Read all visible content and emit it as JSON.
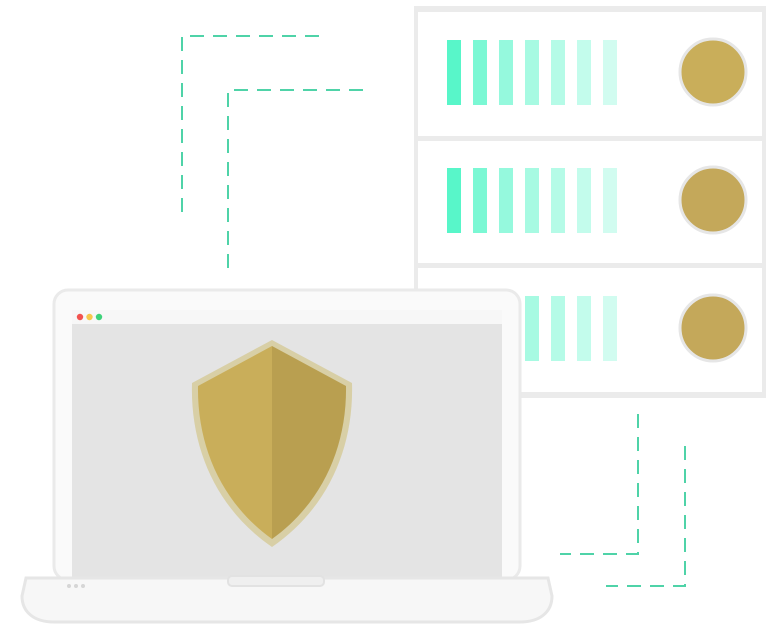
{
  "illustration": {
    "subject": "",
    "colors": {
      "accent": "#4FF5C6",
      "gold": "#C9AE5A",
      "gold_dark": "#B99F50",
      "screen": "#E4E4E4",
      "frame": "#F5F5F5",
      "frame_border": "#EAEAEA",
      "connector": "#4FD3A8"
    },
    "window_buttons": [
      {
        "name": "close",
        "color": "#F2534F"
      },
      {
        "name": "minimize",
        "color": "#F6C84C"
      },
      {
        "name": "maximize",
        "color": "#3ED27A"
      }
    ],
    "server_units": [
      {
        "id": "unit-1",
        "level_indicator_count": 7
      },
      {
        "id": "unit-2",
        "level_indicator_count": 7
      },
      {
        "id": "unit-3",
        "level_indicator_count": 4
      }
    ]
  }
}
